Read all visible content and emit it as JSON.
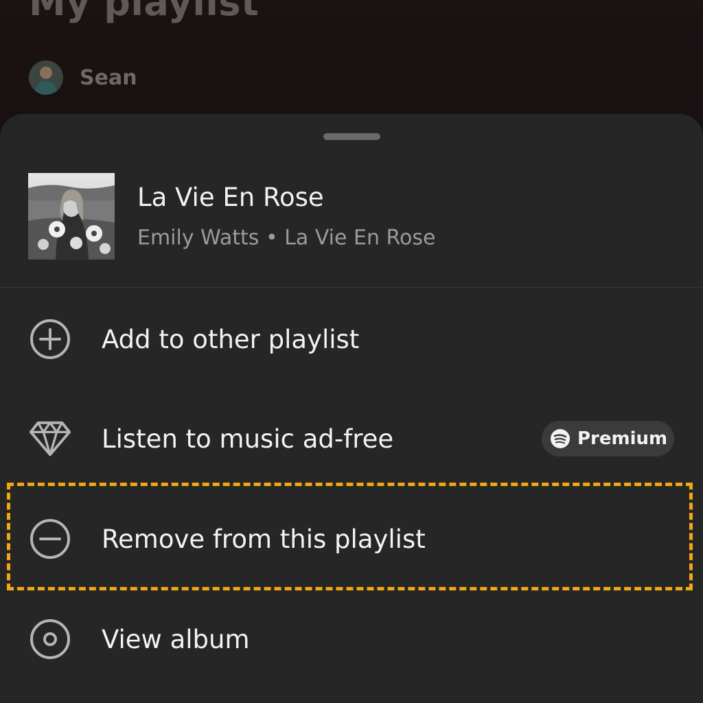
{
  "playlist": {
    "title": "My playlist",
    "owner": "Sean"
  },
  "track": {
    "title": "La Vie En Rose",
    "subtitle": "Emily Watts • La Vie En Rose"
  },
  "menu": {
    "items": [
      {
        "label": "Add to other playlist",
        "icon": "plus-circle-icon"
      },
      {
        "label": "Listen to music ad-free",
        "icon": "diamond-icon",
        "badge": "Premium"
      },
      {
        "label": "Remove from this playlist",
        "icon": "minus-circle-icon"
      },
      {
        "label": "View album",
        "icon": "album-icon"
      }
    ]
  },
  "colors": {
    "sheet_background": "#262626",
    "highlight_border": "#f3a712",
    "primary_text": "#f3f3f3",
    "secondary_text": "#9b9b9b"
  }
}
